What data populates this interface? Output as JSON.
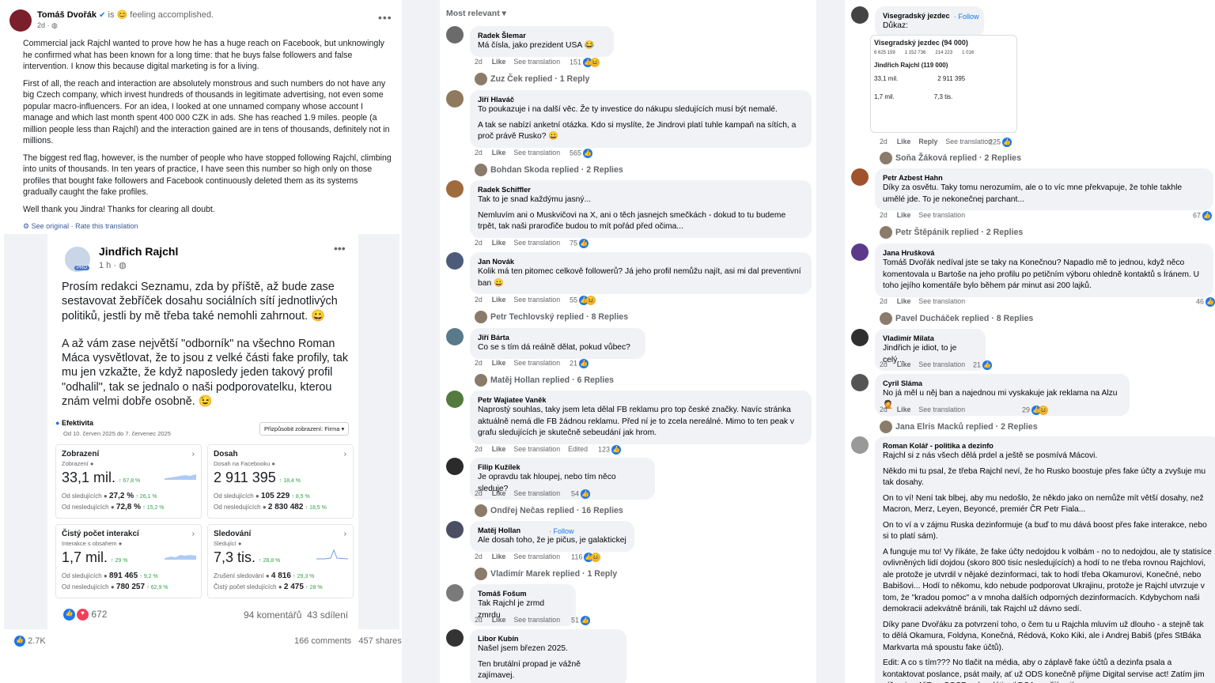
{
  "post": {
    "author": "Tomáš Dvořák",
    "feeling": "is 😊 feeling accomplished.",
    "time": "2d ·",
    "paragraphs": [
      "Commercial jack Rajchl wanted to prove how he has a huge reach on Facebook, but unknowingly he confirmed what has been known for a long time: that he buys false followers and false intervention. I know this because digital marketing is for a living.",
      "First of all, the reach and interaction are absolutely monstrous and such numbers do not have any big Czech company, which invest hundreds of thousands in legitimate advertising, not even some popular macro-influencers. For an idea, I looked at one unnamed company whose account I manage and which last month spent 400 000 CZK in ads. She has reached 1.9 miles. people (a million people less than Rajchl) and the interaction gained are in tens of thousands, definitely not in millions.",
      "The biggest red flag, however, is the number of people who have stopped following Rajchl, climbing into units of thousands. In ten years of practice, I have seen this number so high only on those profiles that bought fake followers and Facebook continuously deleted them as its systems gradually caught the fake profiles.",
      "Well thank you Jindra! Thanks for clearing all doubt."
    ],
    "see_original": "See original · Rate this translation",
    "reactions": "2.7K",
    "comments": "166 comments",
    "shares": "457 shares"
  },
  "embed": {
    "author": "Jindřich Rajchl",
    "time": "1 h ·",
    "badge": "PRO",
    "paragraphs": [
      "Prosím redakci Seznamu, zda by příště, až bude zase sestavovat žebříček dosahu sociálních sítí jednotlivých politiků, jestli by mě třeba také nemohli zahrnout. 😀",
      "A až vám zase největší \"odborník\" na všechno Roman Máca vysvětlovat, že to jsou z velké části fake profily, tak mu jen vzkažte, že když naposledy jeden takový profil \"odhalil\", tak se jednalo o naši podporovatelku, kterou znám velmi dobře osobně. 😉"
    ],
    "eff_title": "Efektivita",
    "eff_range": "Od 10. červen 2025 do 7. červenec 2025",
    "eff_select": "Přizpůsobit zobrazení: Firma ▾",
    "cards": [
      {
        "t": "Zobrazení",
        "s": "Zobrazení ●",
        "v": "33,1 mil.",
        "d": "↑ 67,8 %",
        "l1a": "Od sledujících ●",
        "l1b": "27,2 %",
        "l1c": "↑ 26,1 %",
        "l2a": "Od nesledujících ●",
        "l2b": "72,8 %",
        "l2c": "↑ 15,2 %"
      },
      {
        "t": "Dosah",
        "s": "Dosah na Facebooku ●",
        "v": "2 911 395",
        "d": "↑ 18,4 %",
        "l1a": "Od sledujících ●",
        "l1b": "105 229",
        "l1c": "↑ 8,5 %",
        "l2a": "Od nesledujících ●",
        "l2b": "2 830 482",
        "l2c": "↑ 18,5 %"
      },
      {
        "t": "Čistý počet interakcí",
        "s": "Interakce s obsahem ●",
        "v": "1,7 mil.",
        "d": "↑ 29 %",
        "l1a": "Od sledujících ●",
        "l1b": "891 465",
        "l1c": "↑ 9,2 %",
        "l2a": "Od nesledujících ●",
        "l2b": "780 257",
        "l2c": "↑ 62,9 %"
      },
      {
        "t": "Sledování",
        "s": "Sledující ●",
        "v": "7,3 tis.",
        "d": "↑ 28,8 %",
        "l1a": "Zrušení sledování ●",
        "l1b": "4 816",
        "l1c": "↑ 29,3 %",
        "l2a": "Čistý počet sledujících ●",
        "l2b": "2 475",
        "l2c": "↑ 28 %"
      }
    ],
    "reactions": "672",
    "comments": "94 komentářů",
    "shares": "43 sdílení"
  },
  "sort_label": "Most relevant ▾",
  "middle": [
    {
      "n": "Radek Šlemar",
      "t": [
        "Má čísla, jako prezident USA 😂"
      ],
      "m": "2d",
      "r": "151",
      "rep": "Zuz Ček replied · 1 Reply"
    },
    {
      "n": "Jiří Hlaváč",
      "t": [
        "To poukazuje i na další věc. Že ty investice do nákupu sledujících musí být nemalé.",
        "A tak se nabízí anketní otázka. Kdo si myslíte, že Jindrovi platí tuhle kampaň na sítích, a proč právě Rusko? 😀"
      ],
      "m": "2d",
      "r": "565",
      "rep": "Bohdan Skoda replied · 2 Replies"
    },
    {
      "n": "Radek Schiffler",
      "t": [
        "Tak to je snad každýmu jasný...",
        "Nemluvím ani o Muskvičovi na X, ani o těch jasnejch smečkách - dokud to tu budeme trpět, tak naši praroďiče budou to mít pořád před očima..."
      ],
      "m": "2d",
      "r": "75",
      "rep": ""
    },
    {
      "n": "Jan Novák",
      "t": [
        "Kolik má ten pitomec celkově followerů? Já jeho profil nemůžu najít, asi mi dal preventivní ban 😀"
      ],
      "m": "2d",
      "r": "55",
      "rep": "Petr Techlovský replied · 8 Replies"
    },
    {
      "n": "Jiří Bárta",
      "t": [
        "Co se s tím dá reálně dělat, pokud vůbec?"
      ],
      "m": "2d",
      "r": "21",
      "rep": "Matěj Hollan replied · 6 Replies"
    },
    {
      "n": "Petr Wajiatee Vaněk",
      "t": [
        "Naprostý souhlas, taky jsem leta dělal FB reklamu pro top české značky. Navíc stránka aktuálně nemá dle FB žádnou reklamu. Před ní je to zcela nereálné. Mimo to ten peak v grafu sledujících je skutečně sebeudání jak hrom."
      ],
      "m": "2d",
      "r": "123",
      "ed": "Edited",
      "rep": ""
    },
    {
      "n": "Filip Kužílek",
      "t": [
        "Je opravdu tak hloupej, nebo tím něco sleduje?"
      ],
      "m": "2d",
      "r": "54",
      "rep": "Ondřej Nečas replied · 16 Replies"
    },
    {
      "n": "Matěj Hollan",
      "f": "· Follow",
      "t": [
        "Ale dosah toho, že je pičus, je galaktickej"
      ],
      "m": "2d",
      "r": "116",
      "rep": "Vladimír Marek replied · 1 Reply"
    },
    {
      "n": "Tomáš Fošum",
      "t": [
        "Tak Rajchl je zrmd zmrdu"
      ],
      "m": "2d",
      "r": "51",
      "rep": ""
    },
    {
      "n": "Libor Kubín",
      "t": [
        "Našel jsem březen 2025.",
        "Ten brutální propad je vážně zajímavej."
      ],
      "m": "",
      "r": "",
      "rep": ""
    }
  ],
  "right": [
    {
      "n": "Visegradský jezdec",
      "f": "· Follow",
      "t": [
        "Důkaz:"
      ],
      "m": "2d",
      "reply": "Reply",
      "r": "225",
      "rep": "Soňa Žáková replied · 2 Replies"
    },
    {
      "n": "Petr Azbest Hahn",
      "t": [
        "Díky za osvětu. Taky tomu nerozumím, ale o to víc mne překvapuje, že tohle takhle umělé jde. To je nekonečnej parchant..."
      ],
      "m": "2d",
      "r": "67",
      "rep": "Petr Štěpánik replied · 2 Replies"
    },
    {
      "n": "Jana Hrušková",
      "t": [
        "Tomáš Dvořák nedíval jste se taky na Konečnou? Napadlo mě to jednou, když něco komentovala u Bartoše na jeho profilu po petičním výboru ohledně kontaktů s Íránem. U toho jejího komentáře bylo během pár minut asi 200 lajků."
      ],
      "m": "2d",
      "r": "46",
      "rep": "Pavel Ducháček replied · 8 Replies"
    },
    {
      "n": "Vladimír Milata",
      "t": [
        "Jindřich je idiot, to je celý..."
      ],
      "m": "2d",
      "r": "21",
      "rep": ""
    },
    {
      "n": "Cyril Sláma",
      "t": [
        "No já měl u něj ban a najednou mi vyskakuje jak reklama na Alzu 🤦"
      ],
      "m": "2d",
      "r": "29",
      "rep": "Jana Elris Macků replied · 2 Replies"
    },
    {
      "n": "Roman Kolář - politika a dezinfo",
      "t": [
        "Rajchl si z nás všech dělá prdel a ještě se posmívá Mácovi.",
        "Někdo mi tu psal, že třeba Rajchl neví, že ho Rusko boostuje přes fake účty a zvyšuje mu tak dosahy.",
        "On to ví! Není tak blbej, aby mu nedošlo, že někdo jako on nemůže mít větší dosahy, než Macron, Merz, Leyen, Beyoncé, premiér ČR Petr Fiala...",
        "On to ví a v zájmu Ruska dezinformuje (a buď to mu dává boost přes fake interakce, nebo si to platí sám).",
        "A funguje mu to! Vy říkáte, že fake účty nedojdou k volbám - no to nedojdou, ale ty statisíce ovlivněných lidí dojdou (skoro 800 tisíc nesledujících) a hodí to ne třeba rovnou Rajchlovi, ale protože je utvrdil v nějaké dezinformaci, tak to hodí třeba Okamurovi, Konečné, nebo Babišovi... Hodí to někomu, kdo nebude podporovat Ukrajinu, protože je Rajchl utvrzuje v tom, že \"kradou pomoc\" a v mnoha dalších odporných dezinformacích. Kdybychom naši demokracii adekvátně bránili, tak Rajchl už dávno sedí.",
        "Díky pane Dvořáku za potvrzení toho, o čem tu u Rajchla mluvím už dlouho - a stejně tak to dělá Okamura, Foldyna, Konečná, Rédová, Koko Kiki, ale i Andrej Babiš (přes StBáka Markvarta má spoustu fake účtů).",
        "Edit: A co s tím??? No tlačit na média, aby o záplavě fake účtů a dezinfa psala a kontaktovat poslance, psát maily, ať už ODS konečně přijme Digital servise act! Zatím jim píšou jen AliPro, SOSP a dezoláti, ať DSA nepřijímají."
      ],
      "m": "",
      "r": "",
      "rep": ""
    }
  ],
  "proof": {
    "head": "Visegradský jezdec (94 000)",
    "name": "Jindřich Rajchl (119 000)",
    "v1": "6 625 159",
    "v2": "1 152 736",
    "v3": "214 223",
    "v4": "1 016",
    "a": "33,1 mil.",
    "b": "2 911 395",
    "c": "1,7 mil.",
    "d": "7,3 tis."
  },
  "labels": {
    "like": "Like",
    "see_tr": "See translation",
    "reply": "Reply"
  }
}
